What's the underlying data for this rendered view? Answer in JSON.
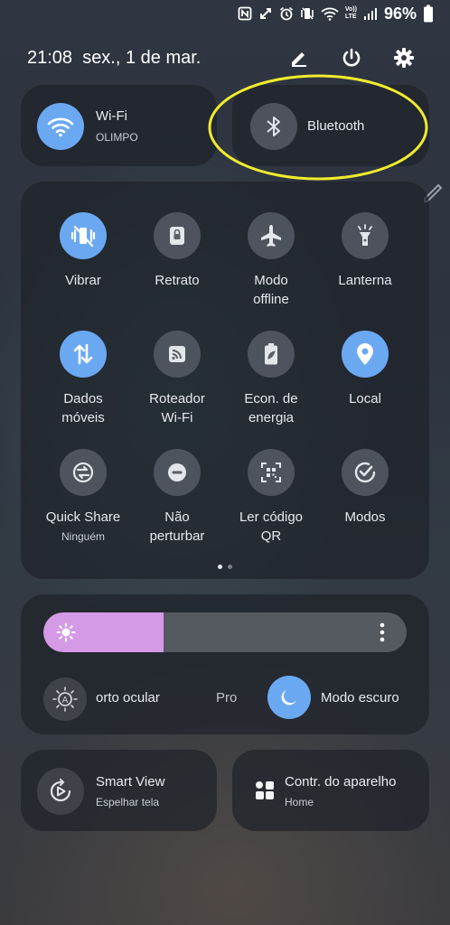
{
  "status_bar": {
    "battery_percent": "96%",
    "icons": [
      "nfc-icon",
      "data-saver-icon",
      "alarm-icon",
      "vibrate-icon",
      "wifi-icon",
      "volte-icon",
      "signal-icon"
    ],
    "volte_label_top": "Vo))",
    "volte_label_bottom": "LTE"
  },
  "header": {
    "time": "21:08",
    "date": "sex., 1 de mar.",
    "edit_icon": "pencil-icon",
    "power_icon": "power-icon",
    "settings_icon": "gear-icon"
  },
  "wifi_tile": {
    "label": "Wi-Fi",
    "network": "OLIMPO",
    "active": true
  },
  "bluetooth_tile": {
    "label": "Bluetooth",
    "active": false,
    "highlight_color": "#f0ec2c"
  },
  "quick_tiles": [
    {
      "label": "Vibrar",
      "active": true,
      "icon": "vibrate-icon"
    },
    {
      "label": "Retrato",
      "active": false,
      "icon": "rotation-lock-icon"
    },
    {
      "label": "Modo\noffline",
      "active": false,
      "icon": "airplane-icon"
    },
    {
      "label": "Lanterna",
      "active": false,
      "icon": "flashlight-icon"
    },
    {
      "label": "Dados\nmóveis",
      "active": true,
      "icon": "mobile-data-icon"
    },
    {
      "label": "Roteador\nWi-Fi",
      "active": false,
      "icon": "hotspot-icon"
    },
    {
      "label": "Econ. de\nenergia",
      "active": false,
      "icon": "battery-saver-icon"
    },
    {
      "label": "Local",
      "active": true,
      "icon": "location-icon"
    },
    {
      "label": "Quick Share",
      "sublabel": "Ninguém",
      "active": false,
      "icon": "quick-share-icon"
    },
    {
      "label": "Não\nperturbar",
      "active": false,
      "icon": "do-not-disturb-icon"
    },
    {
      "label": "Ler código\nQR",
      "active": false,
      "icon": "qr-scan-icon"
    },
    {
      "label": "Modos",
      "active": false,
      "icon": "modes-icon"
    }
  ],
  "page_indicator": {
    "current": 1,
    "total": 2
  },
  "brightness": {
    "level": 0.33,
    "fill_color": "#d59ae6"
  },
  "display_row": {
    "eye_comfort_label": "orto ocular",
    "protection_label_partial": "Pro",
    "dark_mode_label": "Modo escuro",
    "dark_mode_active": true
  },
  "smart_view": {
    "label": "Smart View",
    "sublabel": "Espelhar tela"
  },
  "device_control": {
    "label": "Contr. do aparelho",
    "sublabel": "Home"
  },
  "colors": {
    "accent": "#6ba8f2",
    "card_bg": "#1e222a",
    "highlight": "#f0ec2c"
  }
}
